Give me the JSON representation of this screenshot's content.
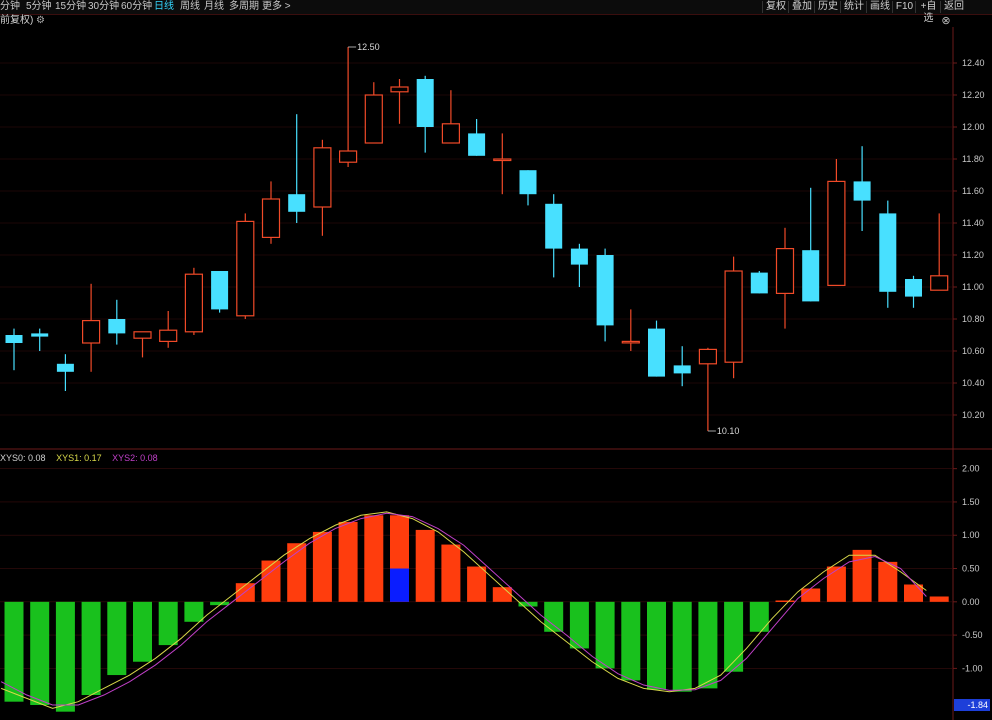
{
  "toolbar": {
    "periods": [
      {
        "label": "分钟",
        "active": false
      },
      {
        "label": "5分钟",
        "active": false
      },
      {
        "label": "15分钟",
        "active": false
      },
      {
        "label": "30分钟",
        "active": false
      },
      {
        "label": "60分钟",
        "active": false
      },
      {
        "label": "日线",
        "active": true
      },
      {
        "label": "周线",
        "active": false
      },
      {
        "label": "月线",
        "active": false
      },
      {
        "label": "多周期",
        "active": false
      },
      {
        "label": "更多 >",
        "active": false
      }
    ],
    "tools": [
      "复权",
      "叠加",
      "历史",
      "统计",
      "画线",
      "F10",
      "+自选",
      "返回"
    ]
  },
  "subtitle": "前复权)",
  "colors": {
    "up": "#f04a28",
    "down": "#48e0ff",
    "bar_pos": "#ff3d0d",
    "bar_neg": "#19c11d",
    "bar_special": "#0a1dff",
    "line1": "#d8d84a",
    "line2": "#c040c8",
    "grid": "#3a0d0d",
    "axis_text": "#c8c8c8"
  },
  "indicator": {
    "xys0_label": "XYS0: 0.08",
    "xys1_label": "XYS1: 0.17",
    "xys2_label": "XYS2: 0.08",
    "current_value": "-1.84"
  },
  "chart_data": [
    {
      "type": "candlestick",
      "ylim": [
        10.0,
        12.6
      ],
      "y_ticks": [
        "12.40",
        "12.20",
        "12.00",
        "11.80",
        "11.60",
        "11.40",
        "11.20",
        "11.00",
        "10.80",
        "10.60",
        "10.40",
        "10.20"
      ],
      "y_tick_values": [
        12.4,
        12.2,
        12.0,
        11.8,
        11.6,
        11.4,
        11.2,
        11.0,
        10.8,
        10.6,
        10.4,
        10.2
      ],
      "annotations": [
        {
          "text": "12.50",
          "index": 13,
          "value": 12.5
        },
        {
          "text": "10.10",
          "index": 27,
          "value": 10.1
        }
      ],
      "candles": [
        {
          "o": 10.7,
          "c": 10.65,
          "h": 10.74,
          "l": 10.48
        },
        {
          "o": 10.71,
          "c": 10.69,
          "h": 10.74,
          "l": 10.6
        },
        {
          "o": 10.52,
          "c": 10.47,
          "h": 10.58,
          "l": 10.35
        },
        {
          "o": 10.65,
          "c": 10.79,
          "h": 11.02,
          "l": 10.47
        },
        {
          "o": 10.8,
          "c": 10.71,
          "h": 10.92,
          "l": 10.64
        },
        {
          "o": 10.68,
          "c": 10.72,
          "h": 10.72,
          "l": 10.56
        },
        {
          "o": 10.66,
          "c": 10.73,
          "h": 10.85,
          "l": 10.62
        },
        {
          "o": 10.72,
          "c": 11.08,
          "h": 11.12,
          "l": 10.7
        },
        {
          "o": 11.1,
          "c": 10.86,
          "h": 11.1,
          "l": 10.84
        },
        {
          "o": 10.82,
          "c": 11.41,
          "h": 11.46,
          "l": 10.8
        },
        {
          "o": 11.31,
          "c": 11.55,
          "h": 11.66,
          "l": 11.27
        },
        {
          "o": 11.58,
          "c": 11.47,
          "h": 12.08,
          "l": 11.4
        },
        {
          "o": 11.5,
          "c": 11.87,
          "h": 11.92,
          "l": 11.32
        },
        {
          "o": 11.78,
          "c": 11.85,
          "h": 12.5,
          "l": 11.75
        },
        {
          "o": 11.9,
          "c": 12.2,
          "h": 12.28,
          "l": 11.9
        },
        {
          "o": 12.22,
          "c": 12.25,
          "h": 12.3,
          "l": 12.02
        },
        {
          "o": 12.3,
          "c": 12.0,
          "h": 12.32,
          "l": 11.84
        },
        {
          "o": 11.9,
          "c": 12.02,
          "h": 12.23,
          "l": 11.9
        },
        {
          "o": 11.96,
          "c": 11.82,
          "h": 12.05,
          "l": 11.82
        },
        {
          "o": 11.8,
          "c": 11.8,
          "h": 11.96,
          "l": 11.58
        },
        {
          "o": 11.73,
          "c": 11.58,
          "h": 11.73,
          "l": 11.51
        },
        {
          "o": 11.52,
          "c": 11.24,
          "h": 11.58,
          "l": 11.06
        },
        {
          "o": 11.24,
          "c": 11.14,
          "h": 11.27,
          "l": 11.0
        },
        {
          "o": 11.2,
          "c": 10.76,
          "h": 11.24,
          "l": 10.66
        },
        {
          "o": 10.66,
          "c": 10.66,
          "h": 10.86,
          "l": 10.6
        },
        {
          "o": 10.74,
          "c": 10.44,
          "h": 10.79,
          "l": 10.44
        },
        {
          "o": 10.51,
          "c": 10.46,
          "h": 10.63,
          "l": 10.38
        },
        {
          "o": 10.52,
          "c": 10.61,
          "h": 10.62,
          "l": 10.1
        },
        {
          "o": 10.53,
          "c": 11.1,
          "h": 11.19,
          "l": 10.43
        },
        {
          "o": 11.09,
          "c": 10.96,
          "h": 11.1,
          "l": 10.96
        },
        {
          "o": 10.96,
          "c": 11.24,
          "h": 11.37,
          "l": 10.74
        },
        {
          "o": 11.23,
          "c": 10.91,
          "h": 11.62,
          "l": 10.91
        },
        {
          "o": 11.01,
          "c": 11.66,
          "h": 11.8,
          "l": 11.01
        },
        {
          "o": 11.66,
          "c": 11.54,
          "h": 11.88,
          "l": 11.35
        },
        {
          "o": 11.46,
          "c": 10.97,
          "h": 11.54,
          "l": 10.87
        },
        {
          "o": 11.05,
          "c": 10.94,
          "h": 11.07,
          "l": 10.87
        },
        {
          "o": 10.98,
          "c": 11.07,
          "h": 11.46,
          "l": 10.98
        }
      ]
    },
    {
      "type": "bar",
      "ylim": [
        -1.7,
        2.1
      ],
      "y_ticks": [
        "2.00",
        "1.50",
        "1.00",
        "0.50",
        "0.00",
        "-0.50",
        "-1.00"
      ],
      "y_tick_values": [
        2.0,
        1.5,
        1.0,
        0.5,
        0.0,
        -0.5,
        -1.0
      ],
      "series": [
        {
          "values": [
            -1.5,
            -1.55,
            -1.65,
            -1.4,
            -1.1,
            -0.9,
            -0.65,
            -0.3,
            -0.05,
            0.28,
            0.62,
            0.88,
            1.05,
            1.2,
            1.3,
            1.3,
            1.08,
            0.86,
            0.53,
            0.22,
            -0.07,
            -0.45,
            -0.7,
            -1.0,
            -1.18,
            -1.32,
            -1.35,
            -1.3,
            -1.05,
            -0.45,
            0.02,
            0.2,
            0.53,
            0.78,
            0.6,
            0.26,
            0.08
          ]
        },
        {
          "values": [
            -1.3,
            -1.45,
            -1.6,
            -1.5,
            -1.3,
            -1.1,
            -0.85,
            -0.55,
            -0.2,
            0.1,
            0.4,
            0.7,
            0.95,
            1.15,
            1.3,
            1.35,
            1.25,
            1.05,
            0.75,
            0.4,
            0.05,
            -0.3,
            -0.6,
            -0.9,
            -1.15,
            -1.3,
            -1.35,
            -1.3,
            -1.1,
            -0.7,
            -0.25,
            0.15,
            0.45,
            0.7,
            0.7,
            0.45,
            0.17
          ]
        },
        {
          "values": [
            -1.2,
            -1.4,
            -1.55,
            -1.55,
            -1.4,
            -1.2,
            -0.95,
            -0.65,
            -0.3,
            0.0,
            0.3,
            0.6,
            0.88,
            1.1,
            1.25,
            1.33,
            1.28,
            1.1,
            0.85,
            0.5,
            0.15,
            -0.2,
            -0.5,
            -0.82,
            -1.08,
            -1.25,
            -1.33,
            -1.32,
            -1.18,
            -0.85,
            -0.4,
            0.05,
            0.35,
            0.6,
            0.68,
            0.5,
            0.08
          ]
        }
      ],
      "highlight": {
        "index": 15,
        "value": 0.5
      }
    }
  ]
}
